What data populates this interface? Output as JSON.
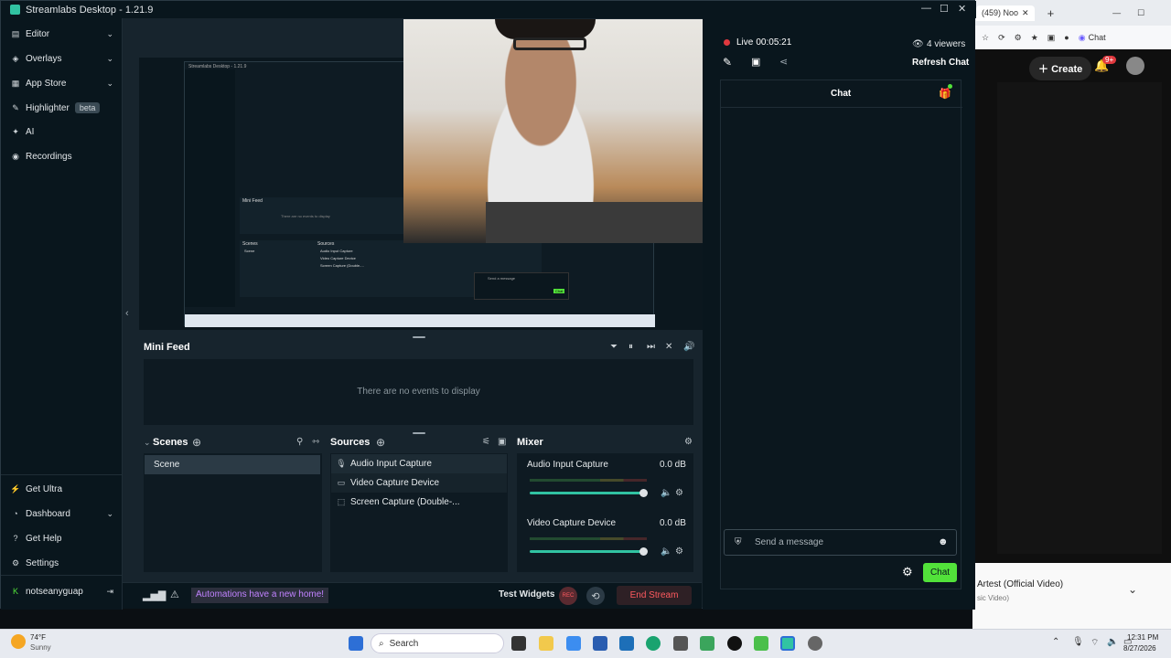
{
  "window": {
    "title": "Streamlabs Desktop - 1.21.9",
    "minimize": "—",
    "maximize": "☐",
    "close": "✕"
  },
  "sidebar": {
    "items": [
      {
        "label": "Editor"
      },
      {
        "label": "Overlays"
      },
      {
        "label": "App Store"
      },
      {
        "label": "Highlighter",
        "badge": "beta"
      },
      {
        "label": "AI"
      },
      {
        "label": "Recordings"
      }
    ],
    "bottom_items": [
      {
        "label": "Get Ultra"
      },
      {
        "label": "Dashboard"
      },
      {
        "label": "Get Help"
      },
      {
        "label": "Settings"
      }
    ],
    "user": "notseanyguap"
  },
  "nested_preview": {
    "title": "Streamlabs Desktop - 1.21.9",
    "mini_feed": "Mini Feed",
    "empty": "There are no events to display",
    "scenes": "Scenes",
    "scene": "Scene",
    "sources": "Sources",
    "src1": "Audio Input Capture",
    "src2": "Video Capture Device",
    "src3": "Screen Capture (Double-...",
    "chat_placeholder": "Send a message",
    "chat": "Chat"
  },
  "mini_feed": {
    "title": "Mini Feed",
    "empty_text": "There are no events to display"
  },
  "scenes": {
    "title": "Scenes",
    "items": [
      "Scene"
    ]
  },
  "sources": {
    "title": "Sources",
    "items": [
      "Audio Input Capture",
      "Video Capture Device",
      "Screen Capture (Double-..."
    ]
  },
  "mixer": {
    "title": "Mixer",
    "channels": [
      {
        "name": "Audio Input Capture",
        "db": "0.0 dB",
        "volume": 1.0
      },
      {
        "name": "Video Capture Device",
        "db": "0.0 dB",
        "volume": 1.0
      }
    ]
  },
  "footer": {
    "automations": "Automations have a new home!",
    "test_widgets": "Test Widgets",
    "rec": "REC",
    "end_stream": "End Stream"
  },
  "live": {
    "label": "Live",
    "time": "00:05:21",
    "viewers": "4 viewers",
    "refresh": "Refresh Chat"
  },
  "chat": {
    "title": "Chat",
    "placeholder": "Send a message",
    "send": "Chat"
  },
  "browser": {
    "tab": "(459) Noo",
    "chat": "Chat",
    "create": "Create",
    "notif": "9+",
    "video_title": "Artest (Official Video)",
    "video_sub": "sic Video)"
  },
  "taskbar": {
    "temp": "74°F",
    "weather": "Sunny",
    "search": "Search",
    "time": "12:31 PM",
    "date": "8/27/2026"
  },
  "colors": {
    "accent": "#31c3a2",
    "live": "#e0383e",
    "end_stream": "#ff5a5f",
    "chat_button": "#52e23a",
    "automation_text": "#c082ff"
  }
}
